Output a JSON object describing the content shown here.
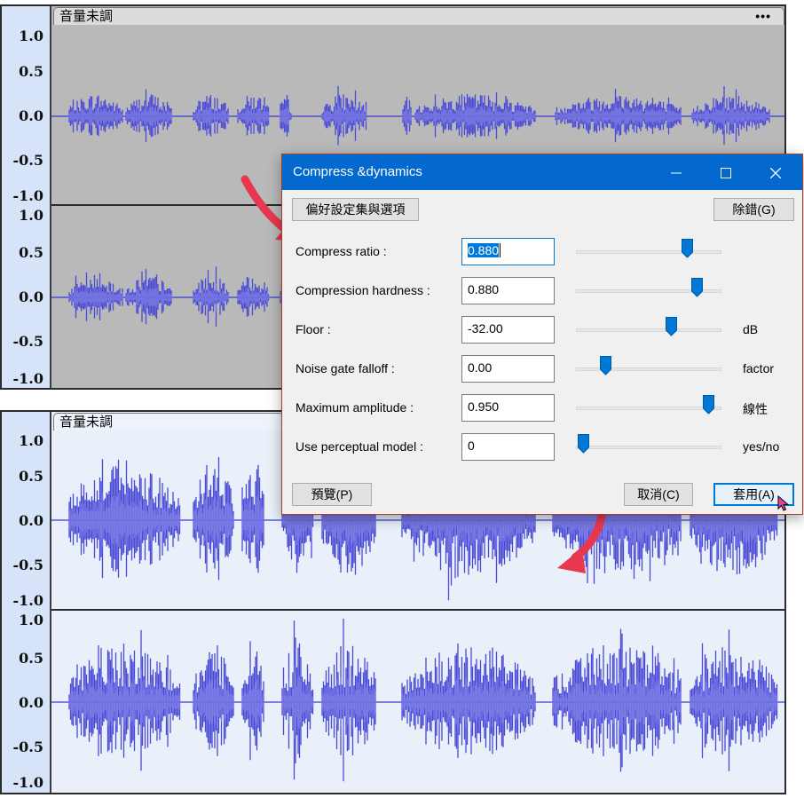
{
  "colors": {
    "wave": "#4a4ad6",
    "wave_highlight": "#7b7be6",
    "center_line": "#3a3ad8",
    "titlebar": "#0369cf",
    "arrow": "#e8384f",
    "dialog_border": "#a83a2e"
  },
  "top_track": {
    "name": "音量未調",
    "menu": "•••",
    "ticks": [
      "1.0",
      "0.5",
      "0.0",
      "-0.5",
      "-1.0",
      "1.0",
      "0.5",
      "0.0",
      "-0.5",
      "-1.0"
    ]
  },
  "bottom_track": {
    "name": "音量未調",
    "ticks": [
      "1.0",
      "0.5",
      "0.0",
      "-0.5",
      "-1.0",
      "1.0",
      "0.5",
      "0.0",
      "-0.5",
      "-1.0"
    ]
  },
  "dialog": {
    "title": "Compress &dynamics",
    "minimize_icon": "minimize-icon",
    "maximize_icon": "maximize-icon",
    "close_icon": "close-icon",
    "presets_button": "偏好設定集與選項",
    "debug_button": "除錯(G)",
    "preview_button": "預覽(P)",
    "cancel_button": "取消(C)",
    "apply_button": "套用(A)",
    "params": [
      {
        "label": "Compress ratio :",
        "value": "0.880",
        "unit": "",
        "slider": 0.76
      },
      {
        "label": "Compression hardness :",
        "value": "0.880",
        "unit": "",
        "slider": 0.83
      },
      {
        "label": "Floor :",
        "value": "-32.00",
        "unit": "dB",
        "slider": 0.65
      },
      {
        "label": "Noise gate falloff :",
        "value": "0.00",
        "unit": "factor",
        "slider": 0.2
      },
      {
        "label": "Maximum amplitude :",
        "value": "0.950",
        "unit": "線性",
        "slider": 0.91
      },
      {
        "label": "Use perceptual model :",
        "value": "0",
        "unit": "yes/no",
        "slider": 0.05
      }
    ]
  }
}
